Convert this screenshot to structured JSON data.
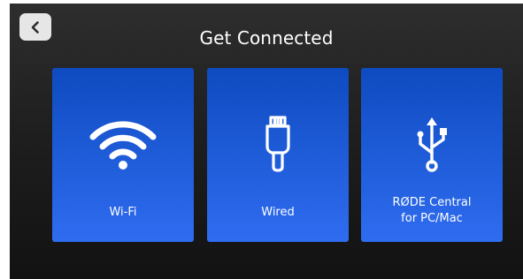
{
  "header": {
    "title": "Get Connected",
    "back_icon": "chevron-left-icon"
  },
  "options": [
    {
      "label": "Wi-Fi",
      "icon": "wifi-icon"
    },
    {
      "label": "Wired",
      "icon": "ethernet-cable-icon"
    },
    {
      "label": "RØDE Central\nfor PC/Mac",
      "icon": "usb-icon"
    }
  ],
  "colors": {
    "tile_top": "#0e4bc0",
    "tile_bottom": "#2f6cf0",
    "background": "#1f1f1f",
    "back_button": "#e6e6e6"
  }
}
